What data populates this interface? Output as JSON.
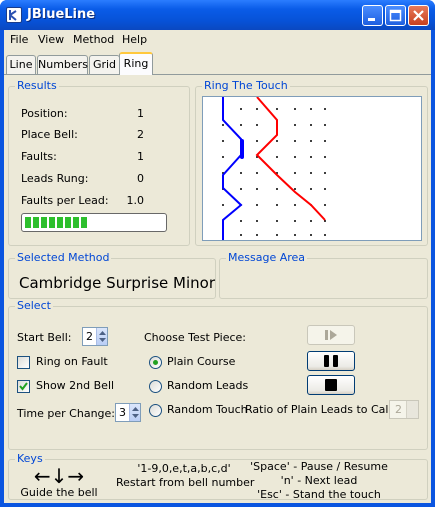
{
  "window": {
    "title": "JBlueLine",
    "accent": "#0b55e0"
  },
  "menu": [
    "File",
    "View",
    "Method",
    "Help"
  ],
  "tabs": [
    "Line",
    "Numbers",
    "Grid",
    "Ring"
  ],
  "active_tab": "Ring",
  "results": {
    "title": "Results",
    "rows": [
      {
        "label": "Position:",
        "value": "1"
      },
      {
        "label": "Place Bell:",
        "value": "2"
      },
      {
        "label": "Faults:",
        "value": "1"
      },
      {
        "label": "Leads Rung:",
        "value": "0"
      },
      {
        "label": "Faults per Lead:",
        "value": "1.0"
      }
    ],
    "progress_percent": 45
  },
  "ring_the_touch": {
    "title": "Ring The Touch",
    "line_colors": {
      "treble": "#0000ff",
      "working": "#ff0000"
    }
  },
  "selected_method": {
    "title": "Selected Method",
    "name": "Cambridge Surprise Minor"
  },
  "message_area": {
    "title": "Message Area",
    "text": ""
  },
  "select": {
    "title": "Select",
    "start_bell_label": "Start Bell:",
    "start_bell_value": "2",
    "ring_on_fault_label": "Ring on Fault",
    "ring_on_fault_checked": false,
    "show_2nd_bell_label": "Show 2nd Bell",
    "show_2nd_bell_checked": true,
    "time_per_change_label": "Time per Change:",
    "time_per_change_value": "3",
    "test_piece_label": "Choose Test Piece:",
    "test_pieces": [
      {
        "label": "Plain Course",
        "selected": true
      },
      {
        "label": "Random Leads",
        "selected": false
      },
      {
        "label": "Random Touch",
        "selected": false
      }
    ],
    "ratio_label": "Ratio of Plain Leads to Calls:",
    "ratio_value": "2",
    "buttons": [
      {
        "icon": "play-icon",
        "enabled": false
      },
      {
        "icon": "pause-icon",
        "enabled": true
      },
      {
        "icon": "stop-icon",
        "enabled": true
      }
    ]
  },
  "keys": {
    "title": "Keys",
    "arrows": "←↓→",
    "guide_label": "Guide the bell",
    "bell_keys": "'1-9,0,e,t,a,b,c,d'",
    "restart_label": "Restart from bell number",
    "space_label": "'Space' - Pause / Resume",
    "n_label": "'n' - Next lead",
    "esc_label": "'Esc' - Stand the touch"
  }
}
